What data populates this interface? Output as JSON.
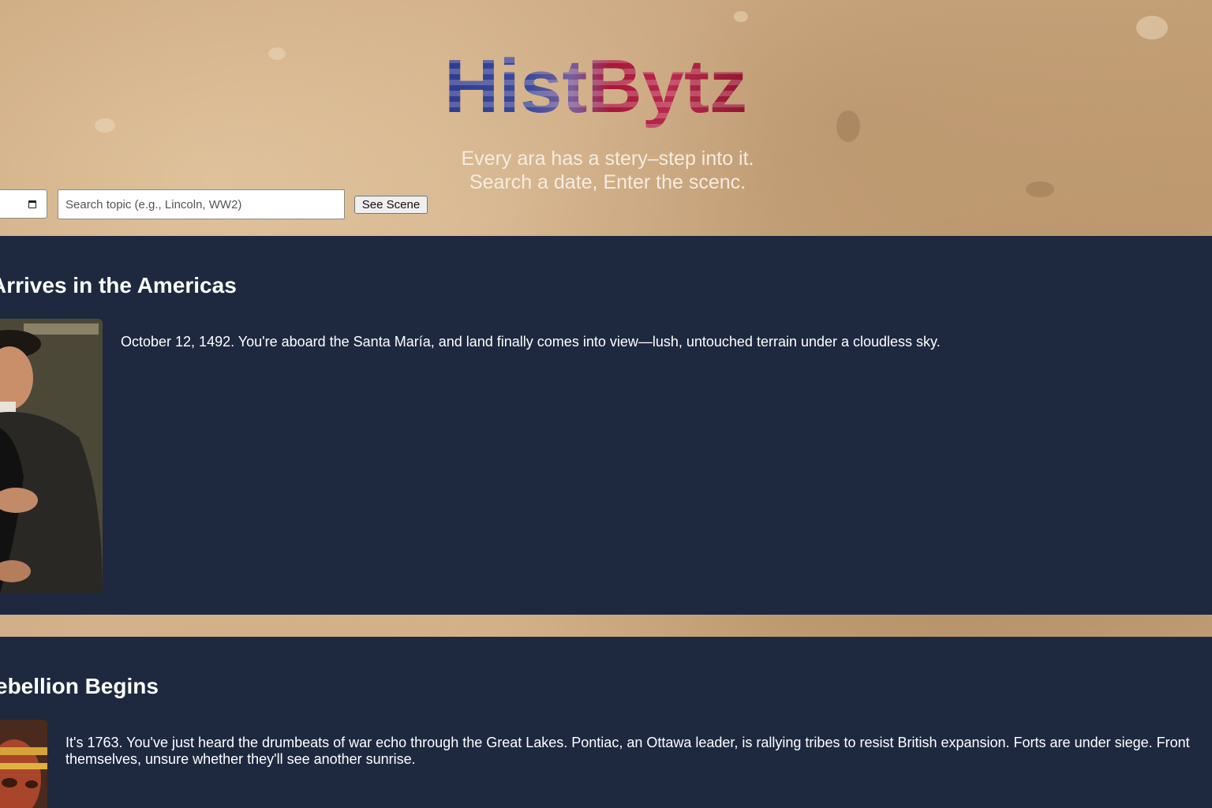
{
  "header": {
    "logo_text": "HistBytz",
    "tagline_line1": "Every ara has a stery–step into it.",
    "tagline_line2": "Search a date, Enter the scenc."
  },
  "search": {
    "placeholder": "Search topic (e.g., Lincoln, WW2)",
    "value": "",
    "button_label": "See Scene"
  },
  "colors": {
    "panel_bg": "#1e2940",
    "paper_bg": "#c9a57c",
    "tagline": "#f4ece0",
    "logo_blue": "#2d3c8f",
    "logo_red": "#a8173a"
  },
  "scenes": [
    {
      "title": "Arrives in the Americas",
      "text": "October 12, 1492. You're aboard the Santa María, and land finally comes into view—lush, untouched terrain under a cloudless sky.",
      "portrait_icon": "portrait-columbus"
    },
    {
      "title": "ebellion Begins",
      "text_line1": "It's 1763. You've just heard the drumbeats of war echo through the Great Lakes. Pontiac, an Ottawa leader, is rallying tribes to resist British expansion. Forts are under siege. Front",
      "text_line2": "themselves, unsure whether they'll see another sunrise.",
      "portrait_icon": "portrait-pontiac"
    }
  ]
}
